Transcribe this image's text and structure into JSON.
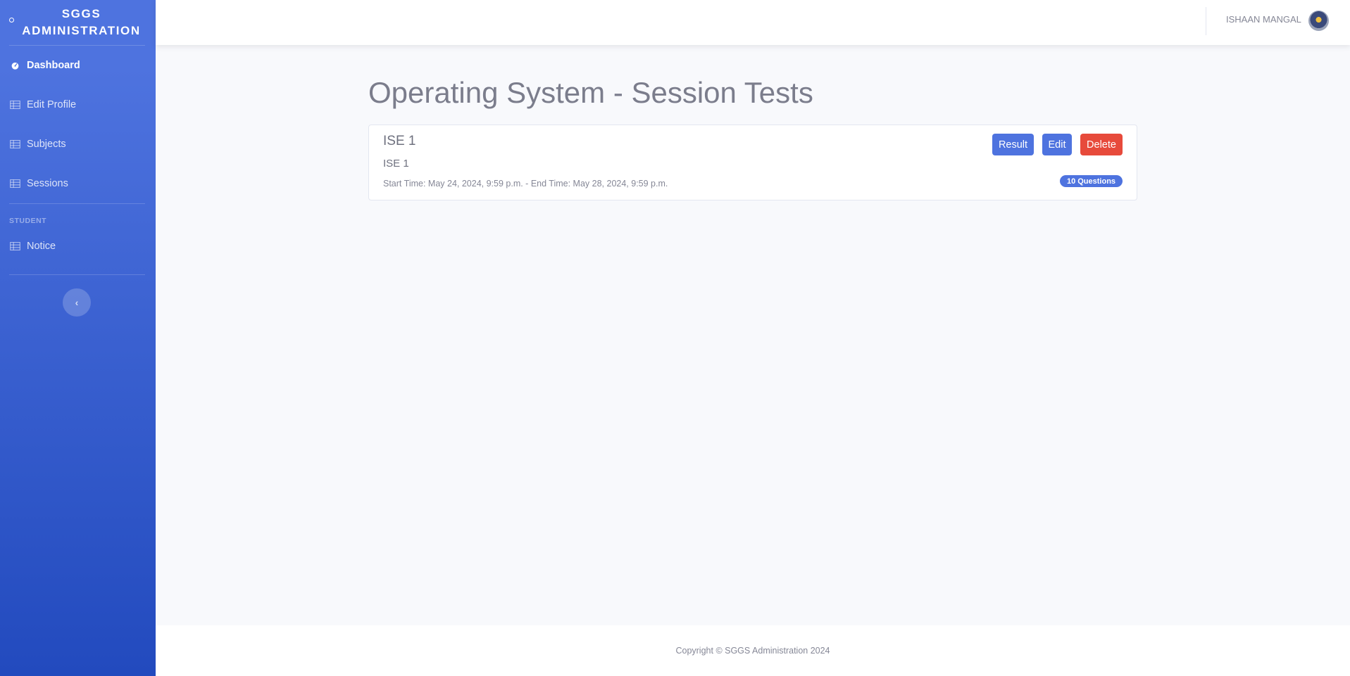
{
  "sidebar": {
    "brand_line1": "SGGS",
    "brand_line2": "ADMINISTRATION",
    "items": [
      {
        "label": "Dashboard",
        "icon": "tachometer-icon"
      },
      {
        "label": "Edit Profile",
        "icon": "table-icon"
      },
      {
        "label": "Subjects",
        "icon": "table-icon"
      },
      {
        "label": "Sessions",
        "icon": "table-icon"
      }
    ],
    "heading": "STUDENT",
    "student_items": [
      {
        "label": "Notice",
        "icon": "table-icon"
      }
    ],
    "toggle_icon": "chevron-left-icon"
  },
  "topbar": {
    "user_name": "ISHAAN MANGAL"
  },
  "main": {
    "title": "Operating System - Session Tests",
    "tests": [
      {
        "title": "ISE 1",
        "description": "ISE 1",
        "times": "Start Time: May 24, 2024, 9:59 p.m. - End Time: May 28, 2024, 9:59 p.m.",
        "result_label": "Result",
        "edit_label": "Edit",
        "delete_label": "Delete",
        "questions_badge": "10 Questions"
      }
    ]
  },
  "footer": {
    "copyright": "Copyright © SGGS Administration 2024"
  },
  "colors": {
    "primary": "#4e73df",
    "danger": "#e74a3b",
    "background": "#f8f9fc"
  }
}
